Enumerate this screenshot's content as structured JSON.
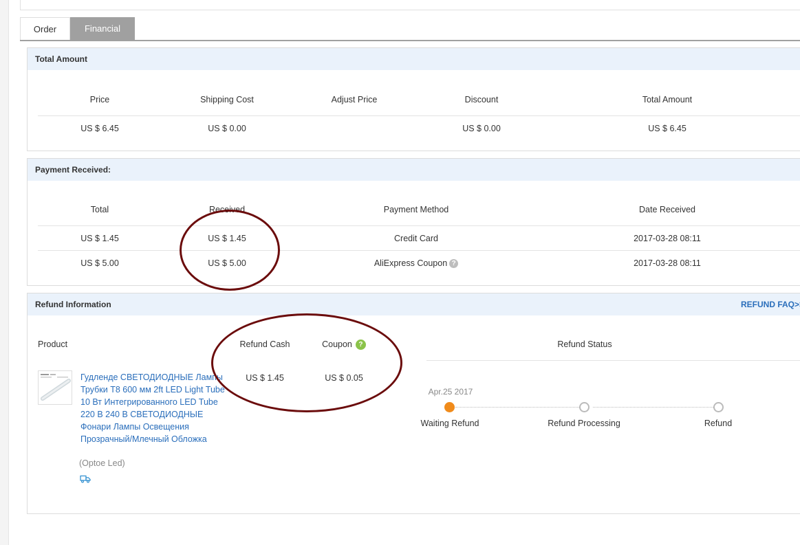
{
  "tabs": {
    "order": "Order",
    "financial": "Financial"
  },
  "total_amount": {
    "title": "Total Amount",
    "headers": {
      "price": "Price",
      "shipping": "Shipping Cost",
      "adjust": "Adjust Price",
      "discount": "Discount",
      "total": "Total Amount"
    },
    "row": {
      "price": "US $ 6.45",
      "shipping": "US $ 0.00",
      "adjust": "",
      "discount": "US $ 0.00",
      "total": "US $ 6.45"
    }
  },
  "payment": {
    "title": "Payment Received:",
    "headers": {
      "total": "Total",
      "received": "Received",
      "method": "Payment Method",
      "date": "Date Received"
    },
    "rows": [
      {
        "total": "US $ 1.45",
        "received": "US $ 1.45",
        "method": "Credit Card",
        "date": "2017-03-28 08:11"
      },
      {
        "total": "US $ 5.00",
        "received": "US $ 5.00",
        "method": "AliExpress Coupon",
        "date": "2017-03-28 08:11"
      }
    ],
    "help_glyph": "?"
  },
  "refund": {
    "title": "Refund Information",
    "faq": "REFUND FAQ>>",
    "headers": {
      "product": "Product",
      "cash": "Refund Cash",
      "coupon": "Coupon",
      "status": "Refund Status"
    },
    "coupon_help_glyph": "?",
    "product_name": "Гудленде СВЕТОДИОДНЫЕ Лампы Трубки T8 600 мм 2ft LED Light Tube 10 Вт Интегрированного LED Tube 220 В 240 В СВЕТОДИОДНЫЕ Фонари Лампы Освещения Прозрачный/Млечный Обложка",
    "seller": "(Optoe Led)",
    "cash": "US $ 1.45",
    "coupon": "US $ 0.05",
    "progress": {
      "date": "Apr.25 2017",
      "current_step": 1,
      "steps": [
        "Waiting Refund",
        "Refund Processing",
        "Refund"
      ]
    }
  },
  "icons": {
    "truck": "truck-icon",
    "help": "question-icon",
    "product_image": "led-tube-thumbnail"
  },
  "colors": {
    "link": "#2a6ebb",
    "header_bg": "#eaf2fb",
    "active_step": "#f08b1b",
    "annotation": "#6b0c0c",
    "tab_active": "#a0a0a0"
  }
}
